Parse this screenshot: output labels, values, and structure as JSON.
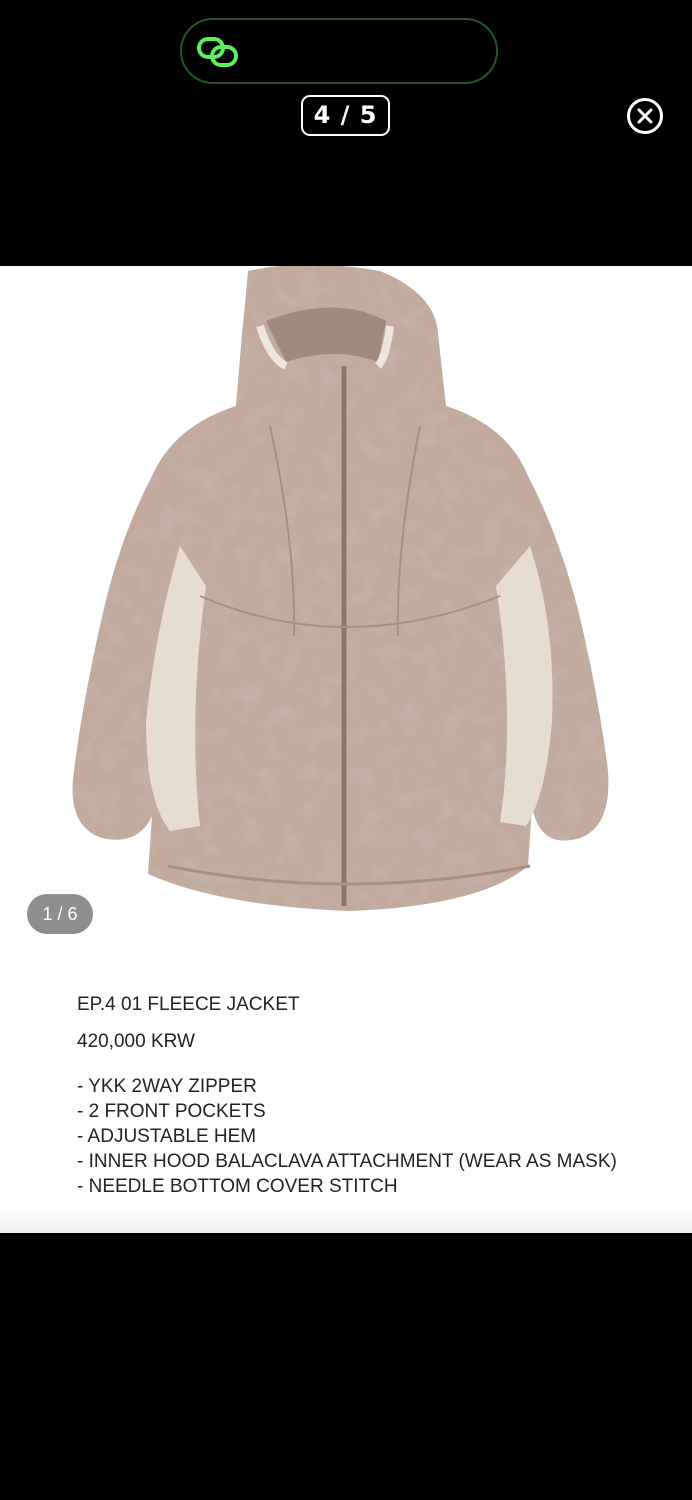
{
  "header": {
    "counter": "4 / 5",
    "icons": {
      "link": "link-chain-icon",
      "close": "close-circle-icon"
    },
    "accent_color": "#5cf05c"
  },
  "product": {
    "image_counter": "1 / 6",
    "title": "EP.4 01 FLEECE JACKET",
    "price": "420,000 KRW",
    "features": [
      "- YKK 2WAY ZIPPER",
      "- 2 FRONT POCKETS",
      "- ADJUSTABLE HEM",
      "- INNER HOOD BALACLAVA ATTACHMENT (WEAR AS MASK)",
      "- NEEDLE BOTTOM COVER STITCH"
    ]
  }
}
